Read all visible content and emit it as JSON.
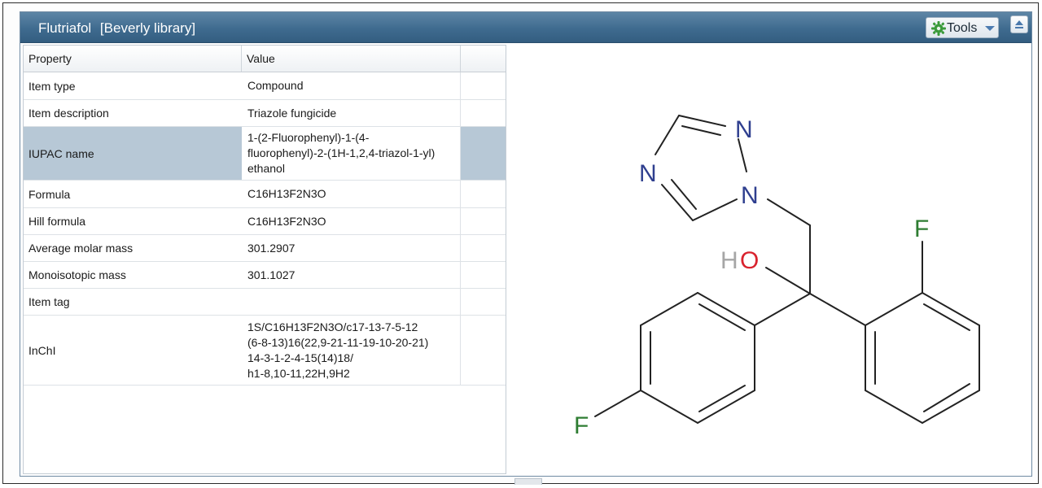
{
  "window": {
    "title": "Flutriafol",
    "library": "[Beverly library]"
  },
  "toolbar": {
    "tools_label": "Tools"
  },
  "grid": {
    "columns": [
      "Property",
      "Value"
    ],
    "rows": [
      {
        "property": "Item type",
        "value": "Compound"
      },
      {
        "property": "Item description",
        "value": "Triazole fungicide"
      },
      {
        "property": "IUPAC name",
        "value": "1-(2-Fluorophenyl)-1-(4-\nfluorophenyl)-2-(1H-1,2,4-triazol-1-yl)\nethanol"
      },
      {
        "property": "Formula",
        "value": "C16H13F2N3O"
      },
      {
        "property": "Hill formula",
        "value": "C16H13F2N3O"
      },
      {
        "property": "Average molar mass",
        "value": "301.2907"
      },
      {
        "property": "Monoisotopic mass",
        "value": "301.1027"
      },
      {
        "property": "Item tag",
        "value": ""
      },
      {
        "property": "InChI",
        "value": "1S/C16H13F2N3O/c17-13-7-5-12\n(6-8-13)16(22,9-21-11-19-10-20-21)\n14-3-1-2-4-15(14)18/\nh1-8,10-11,22H,9H2"
      }
    ],
    "selected_row_index": 2
  },
  "structure": {
    "atom_labels": {
      "n_top": "N",
      "n_left": "N",
      "n_bottom": "N",
      "h": "H",
      "o": "O",
      "f_right": "F",
      "f_left": "F"
    },
    "colors": {
      "nitrogen": "#2f3f8f",
      "oxygen": "#d9232e",
      "fluorine": "#2e7d32",
      "hydrogen": "#a6a6a6",
      "bond": "#222222"
    }
  },
  "colors": {
    "titlebar": "#3f6b8f",
    "selected_row": "#b7c8d6",
    "gear": "#3a9a3a",
    "caret": "#4c7bb0"
  }
}
